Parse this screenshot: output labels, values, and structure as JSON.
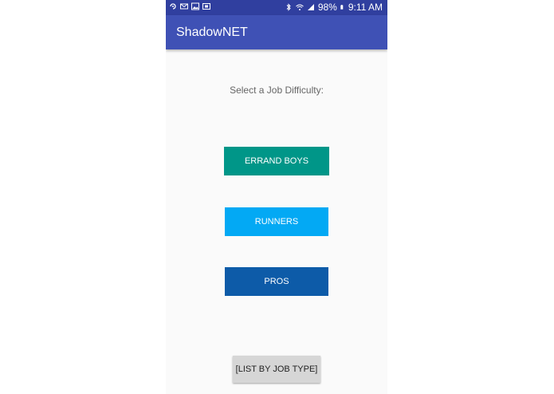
{
  "status_bar": {
    "battery": "98%",
    "time": "9:11 AM",
    "icons_left": [
      "sync-icon",
      "mail-icon",
      "image-icon",
      "screenshot-icon"
    ],
    "icons_right": [
      "bluetooth-icon",
      "wifi-icon",
      "signal-icon",
      "battery-icon"
    ]
  },
  "app_bar": {
    "title": "ShadowNET",
    "color": "#3f51b5"
  },
  "main": {
    "prompt": "Select a Job Difficulty:",
    "buttons": [
      {
        "label": "ERRAND BOYS",
        "color": "#009688"
      },
      {
        "label": "RUNNERS",
        "color": "#03a9f4"
      },
      {
        "label": "PROS",
        "color": "#0d5ba8"
      }
    ],
    "list_button": "[LIST BY JOB TYPE]"
  }
}
